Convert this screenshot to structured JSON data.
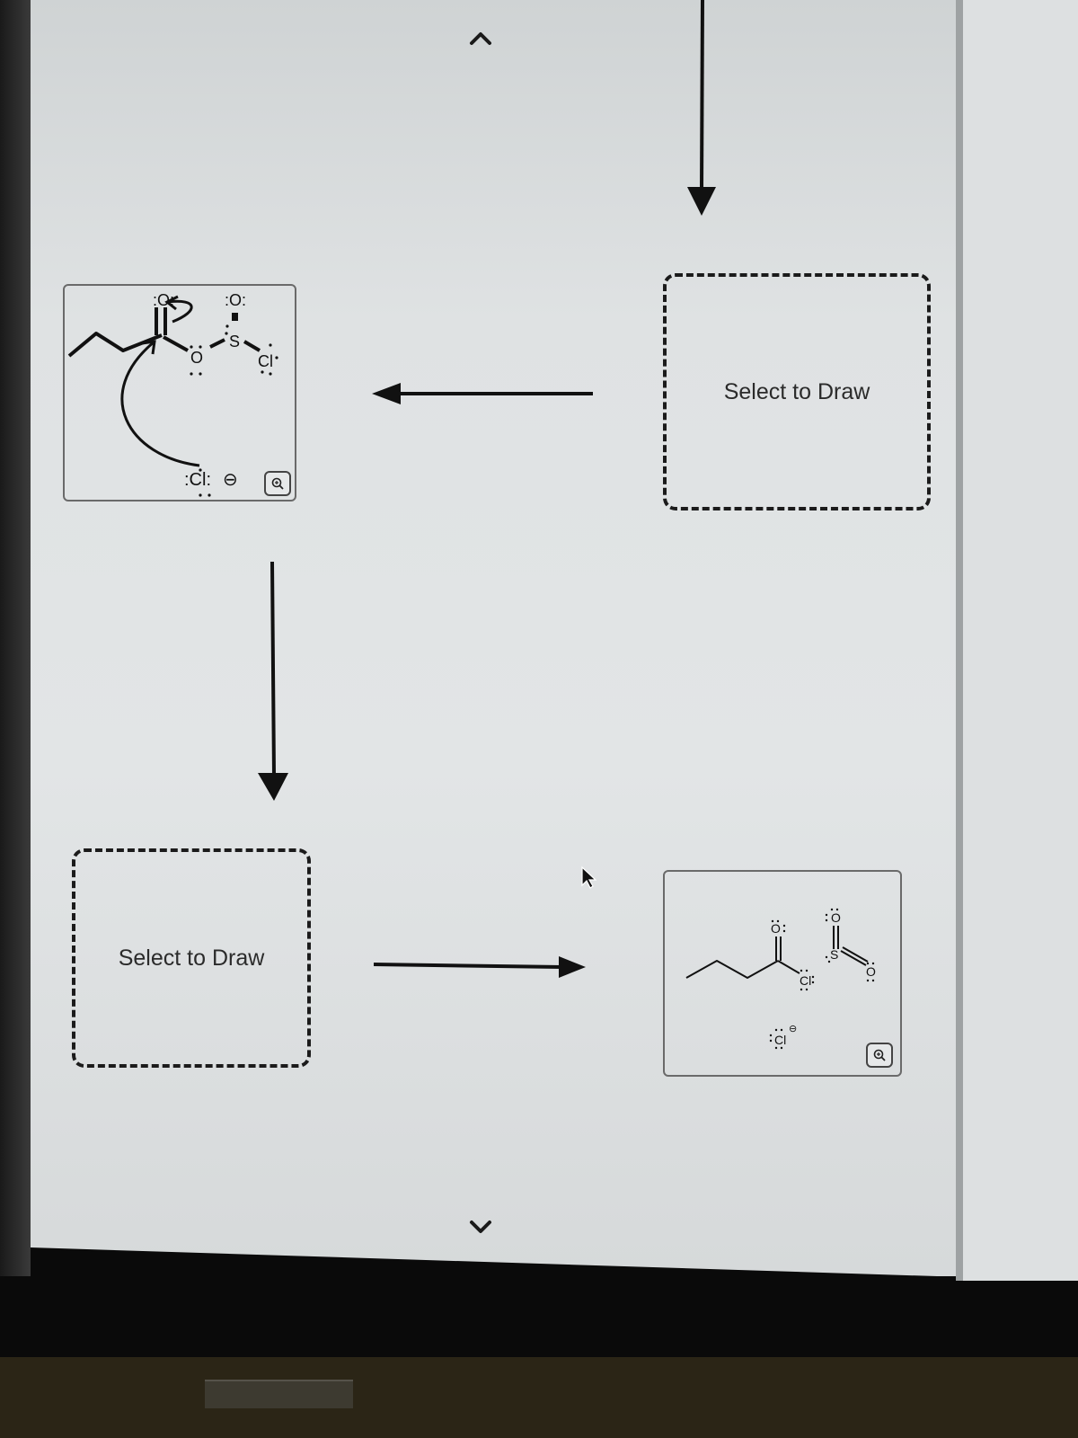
{
  "mechanism": {
    "step1": {
      "molecule_labels": {
        "carbonyl_oxygen": ":O:",
        "sulfinyl_oxygen": ":O:",
        "ester_oxygen": "O",
        "sulfur": "S",
        "chlorine": "Cl",
        "chloride_ion": ":Cl:",
        "charge": "⊖"
      },
      "zoom_icon": "magnifier-plus-icon"
    },
    "step2": {
      "placeholder": "Select to Draw"
    },
    "step3": {
      "placeholder": "Select to Draw"
    },
    "step4": {
      "molecule_labels": {
        "acyl_oxygen": "O",
        "acyl_chlorine": "Cl",
        "so2_oxygen_top": "O",
        "so2_sulfur": "S",
        "so2_oxygen_right": "O",
        "chloride_ion": "Cl",
        "charge": "⊖"
      },
      "zoom_icon": "magnifier-plus-icon"
    }
  },
  "navigation": {
    "scroll_up_icon": "chevron-up-icon",
    "scroll_down_icon": "chevron-down-icon"
  }
}
